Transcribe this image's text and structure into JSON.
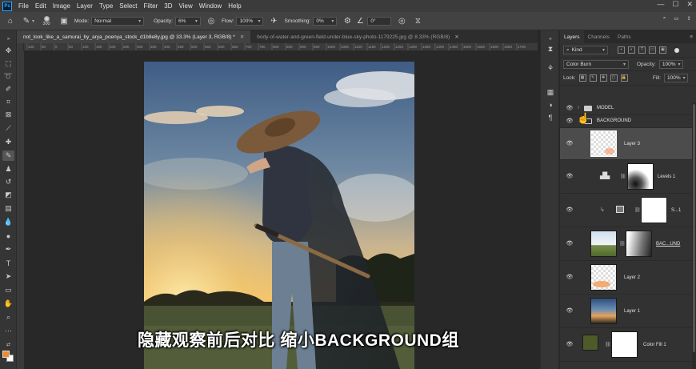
{
  "menubar": {
    "logo": "Ps",
    "items": [
      "File",
      "Edit",
      "Image",
      "Layer",
      "Type",
      "Select",
      "Filter",
      "3D",
      "View",
      "Window",
      "Help"
    ]
  },
  "options": {
    "brush_size": "300",
    "mode_label": "Mode:",
    "mode_value": "Normal",
    "opacity_label": "Opacity:",
    "opacity_value": "6%",
    "flow_label": "Flow:",
    "flow_value": "100%",
    "smoothing_label": "Smoothing:",
    "smoothing_value": "0%",
    "angle_value": "0°"
  },
  "tabs": [
    {
      "label": "not_look_like_a_samurai_by_arya_poenya_stock_d1b8e8y.jpg @ 33.3% (Layer 3, RGB/8) *",
      "active": true
    },
    {
      "label": "body-of-water-and-green-field-under-blue-sky-photo-1179225.jpg @ 8.33% (RGB/8)",
      "active": false
    }
  ],
  "ruler": {
    "ticks": [
      "100",
      "50",
      "0",
      "50",
      "100",
      "150",
      "200",
      "250",
      "300",
      "350",
      "400",
      "450",
      "500",
      "550",
      "600",
      "650",
      "700",
      "750",
      "800",
      "850",
      "900",
      "950",
      "1000",
      "1050",
      "1100",
      "1150",
      "1200",
      "1250",
      "1300",
      "1350",
      "1400",
      "1450",
      "1500",
      "1550",
      "1600",
      "1650",
      "1700"
    ]
  },
  "subtitle": "隐藏观察前后对比 缩小BACKGROUND组",
  "panel": {
    "tabs": [
      "Layers",
      "Channels",
      "Paths"
    ],
    "kind_label": "Kind",
    "blend_mode": "Color Burn",
    "opacity_label": "Opacity:",
    "opacity_value": "100%",
    "lock_label": "Lock:",
    "fill_label": "Fill:",
    "fill_value": "100%",
    "layers": [
      {
        "name": "MODEL",
        "type": "group",
        "collapsed": true
      },
      {
        "name": "BACKGROUND",
        "type": "group",
        "collapsed": false
      },
      {
        "name": "Layer 3",
        "type": "pixel",
        "selected": true
      },
      {
        "name": "Levels 1",
        "type": "adjustment"
      },
      {
        "name": "S...1",
        "type": "adjustment"
      },
      {
        "name": "BAC...UND",
        "type": "masked"
      },
      {
        "name": "Layer 2",
        "type": "pixel"
      },
      {
        "name": "Layer 1",
        "type": "pixel"
      },
      {
        "name": "Color Fill 1",
        "type": "fill"
      }
    ]
  },
  "colors": {
    "foreground": "#f08a2a",
    "background": "#ffffff",
    "color_fill_swatch": "#4f5a2a"
  }
}
